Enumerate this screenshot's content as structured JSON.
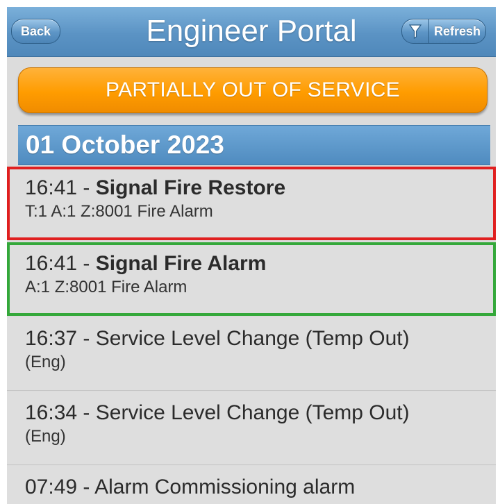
{
  "header": {
    "back_label": "Back",
    "title": "Engineer Portal",
    "refresh_label": "Refresh",
    "filter_icon": "filter-icon"
  },
  "status_banner": {
    "label": "PARTIALLY OUT OF SERVICE",
    "color": "#ff9c00"
  },
  "date_header": "01 October 2023",
  "events": [
    {
      "time": "16:41",
      "title": "Signal Fire Restore",
      "detail": "T:1 A:1 Z:8001 Fire Alarm",
      "bold": true,
      "highlight": "#e02020"
    },
    {
      "time": "16:41",
      "title": "Signal Fire Alarm",
      "detail": "A:1 Z:8001 Fire Alarm",
      "bold": true,
      "highlight": "#34a83a"
    },
    {
      "time": "16:37",
      "title": "Service Level Change (Temp Out)",
      "detail": "(Eng)",
      "bold": false
    },
    {
      "time": "16:34",
      "title": "Service Level Change (Temp Out)",
      "detail": "(Eng)",
      "bold": false
    },
    {
      "time": "07:49",
      "title": "Alarm Commissioning alarm",
      "detail": "",
      "bold": false
    }
  ]
}
